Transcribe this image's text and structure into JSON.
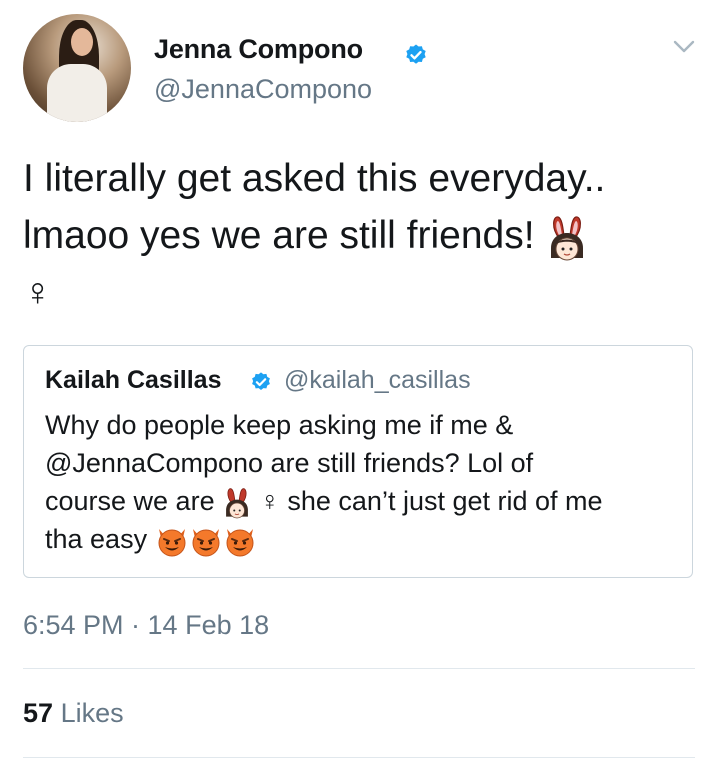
{
  "author": {
    "display_name": "Jenna Compono",
    "handle": "@JennaCompono",
    "verified": true
  },
  "tweet": {
    "line1": "I literally get asked this everyday..",
    "line2": "lmaoo yes we are still friends!",
    "emoji_line2": "woman-with-bunny-ears",
    "line3": "♀"
  },
  "quoted_tweet": {
    "display_name": "Kailah Casillas",
    "handle": "@kailah_casillas",
    "verified": true,
    "line1": "Why do people keep asking me if me &",
    "line2": "@JennaCompono are still friends? Lol of",
    "line3_a": "course we are",
    "line3_b": "♀ she can’t just get rid of me",
    "line4": "tha easy",
    "emojis": [
      "woman-with-bunny-ears",
      "smiling-imp",
      "smiling-imp",
      "smiling-imp"
    ]
  },
  "timestamp": "6:54 PM · 14 Feb 18",
  "stats": {
    "likes_count": "57",
    "likes_label": "Likes"
  },
  "colors": {
    "verified_blue": "#1da1f2",
    "secondary_text": "#657786",
    "divider": "#e1e8ed",
    "imp_orange": "#f4792b"
  }
}
